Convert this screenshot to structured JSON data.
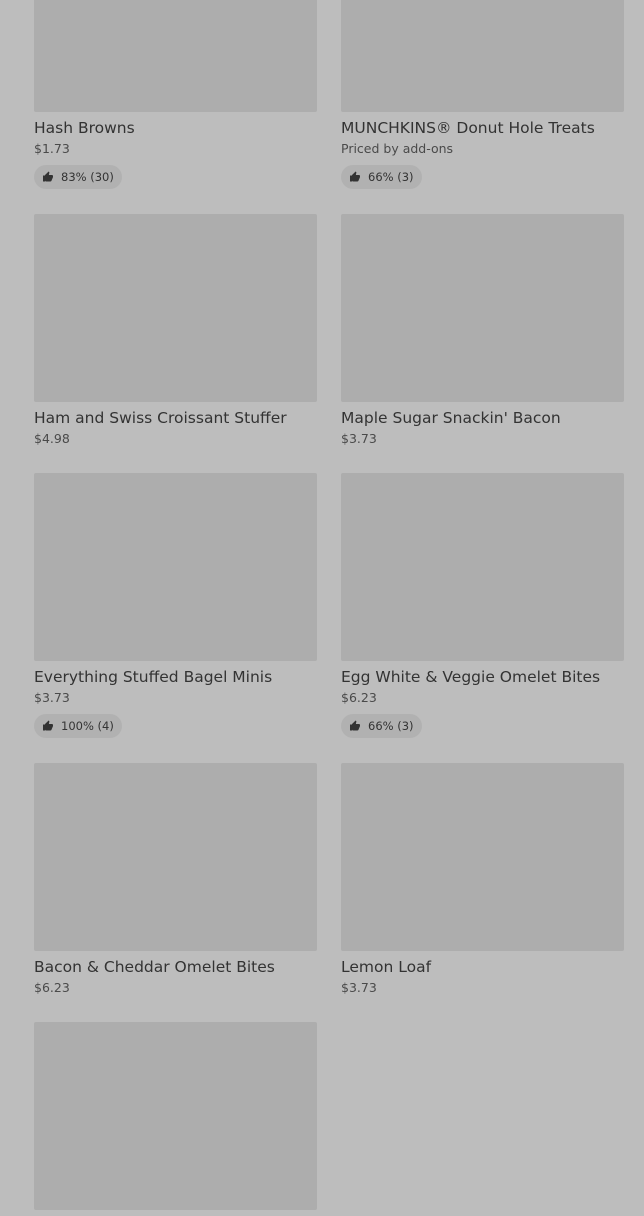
{
  "products": [
    {
      "name": "Hash Browns",
      "price": "$1.73",
      "rating": "83% (30)",
      "rating_icon": "thumbs-up-icon"
    },
    {
      "name": "MUNCHKINS® Donut Hole Treats",
      "price": "Priced by add-ons",
      "rating": "66% (3)",
      "rating_icon": "thumbs-up-icon"
    },
    {
      "name": "Ham and Swiss Croissant Stuffer",
      "price": "$4.98",
      "rating": null
    },
    {
      "name": "Maple Sugar Snackin' Bacon",
      "price": "$3.73",
      "rating": null
    },
    {
      "name": "Everything Stuffed Bagel Minis",
      "price": "$3.73",
      "rating": "100% (4)",
      "rating_icon": "thumbs-up-icon"
    },
    {
      "name": "Egg White & Veggie Omelet Bites",
      "price": "$6.23",
      "rating": "66% (3)",
      "rating_icon": "thumbs-up-icon"
    },
    {
      "name": "Bacon & Cheddar Omelet Bites",
      "price": "$6.23",
      "rating": null
    },
    {
      "name": "Lemon Loaf",
      "price": "$3.73",
      "rating": null
    },
    {
      "name": "",
      "price": "",
      "rating": null
    }
  ],
  "colors": {
    "background": "#bdbdbd",
    "image_placeholder": "#adadad",
    "rating_pill": "#b1b1b1",
    "text": "#333333"
  }
}
